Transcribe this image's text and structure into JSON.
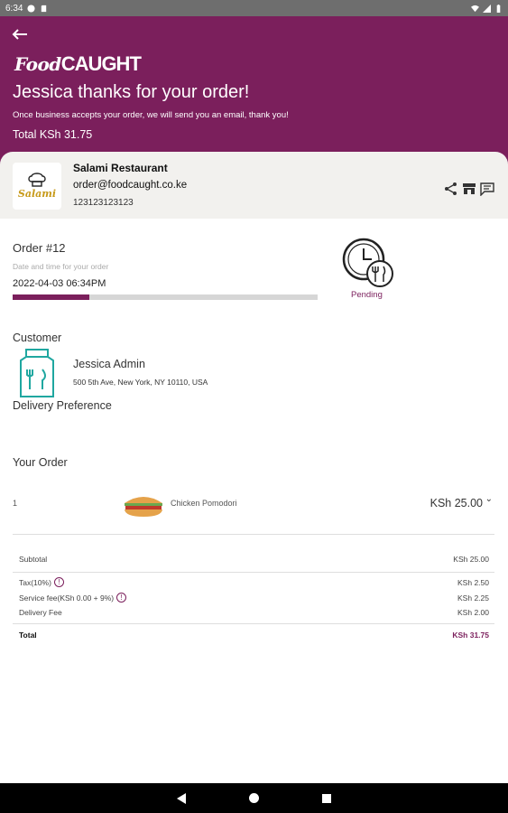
{
  "status_bar": {
    "time": "6:34"
  },
  "hero": {
    "brand_food": "Food",
    "brand_caught": "CAUGHT",
    "thanks": "Jessica thanks for your order!",
    "note": "Once business accepts your order, we will send you an email, thank you!",
    "total": "Total KSh 31.75"
  },
  "restaurant": {
    "logo_text": "Salami",
    "name": "Salami Restaurant",
    "email": "order@foodcaught.co.ke",
    "phone": "123123123123"
  },
  "order": {
    "title": "Order #12",
    "datetime_label": "Date and time for your order",
    "datetime": "2022-04-03 06:34PM",
    "progress_fraction": 0.25,
    "status": "Pending"
  },
  "customer": {
    "label": "Customer",
    "name": "Jessica Admin",
    "address": "500 5th Ave, New York, NY 10110, USA",
    "delivery_preference_label": "Delivery Preference"
  },
  "your_order": {
    "label": "Your Order",
    "items": [
      {
        "qty": "1",
        "name": "Chicken Pomodori",
        "price": "KSh 25.00"
      }
    ]
  },
  "summary": {
    "subtotal_label": "Subtotal",
    "subtotal": "KSh 25.00",
    "tax_label": "Tax(10%)",
    "tax": "KSh 2.50",
    "service_label": "Service fee(KSh 0.00 + 9%)",
    "service": "KSh 2.25",
    "delivery_label": "Delivery Fee",
    "delivery": "KSh 2.00",
    "total_label": "Total",
    "total": "KSh 31.75"
  },
  "colors": {
    "brand": "#7b1f5c",
    "card": "#f2f1ee",
    "teal": "#1fa7a0"
  },
  "icons": [
    "arrow-left-icon",
    "share-icon",
    "store-icon",
    "message-icon",
    "clock-icon",
    "bag-icon",
    "info-icon",
    "chevron-down-icon"
  ]
}
